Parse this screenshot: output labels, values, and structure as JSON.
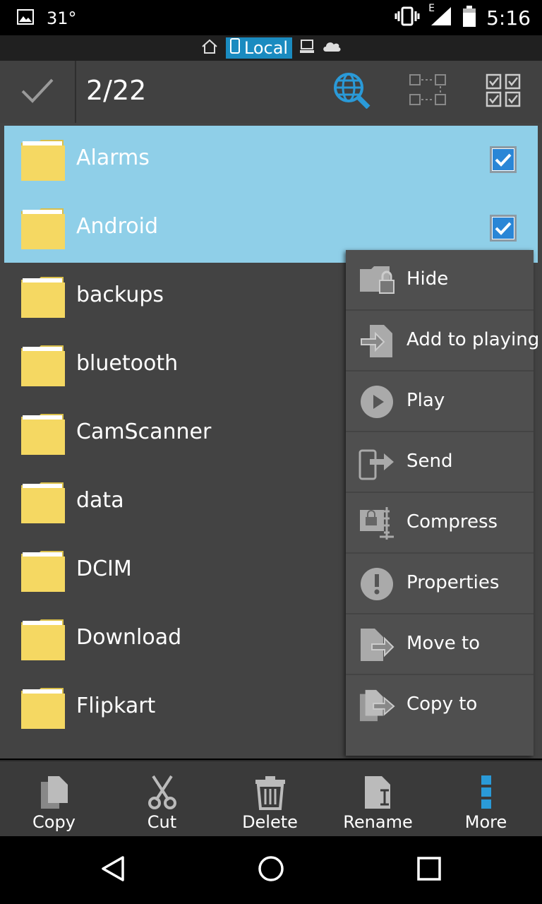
{
  "status_bar": {
    "temperature": "31°",
    "network_type": "E",
    "time": "5:16"
  },
  "location_bar": {
    "local_label": "Local"
  },
  "action_bar": {
    "selection_count": "2/22"
  },
  "files": [
    {
      "name": "Alarms",
      "selected": true
    },
    {
      "name": "Android",
      "selected": true
    },
    {
      "name": "backups",
      "selected": false
    },
    {
      "name": "bluetooth",
      "selected": false
    },
    {
      "name": "CamScanner",
      "selected": false
    },
    {
      "name": "data",
      "selected": false
    },
    {
      "name": "DCIM",
      "selected": false
    },
    {
      "name": "Download",
      "selected": false
    },
    {
      "name": "Flipkart",
      "selected": false
    }
  ],
  "popup_menu": {
    "items": [
      {
        "label": "Hide",
        "icon": "folder-lock-icon"
      },
      {
        "label": "Add to playing",
        "icon": "add-to-playlist-icon"
      },
      {
        "label": "Play",
        "icon": "play-icon"
      },
      {
        "label": "Send",
        "icon": "send-icon"
      },
      {
        "label": "Compress",
        "icon": "compress-icon"
      },
      {
        "label": "Properties",
        "icon": "info-icon"
      },
      {
        "label": "Move to",
        "icon": "move-to-icon"
      },
      {
        "label": "Copy to",
        "icon": "copy-to-icon"
      }
    ]
  },
  "toolbar": {
    "copy_label": "Copy",
    "cut_label": "Cut",
    "delete_label": "Delete",
    "rename_label": "Rename",
    "more_label": "More"
  },
  "colors": {
    "selection": "#8fcfe8",
    "accent": "#2a86d6",
    "list_bg": "#434343",
    "folder": "#f5d862"
  }
}
